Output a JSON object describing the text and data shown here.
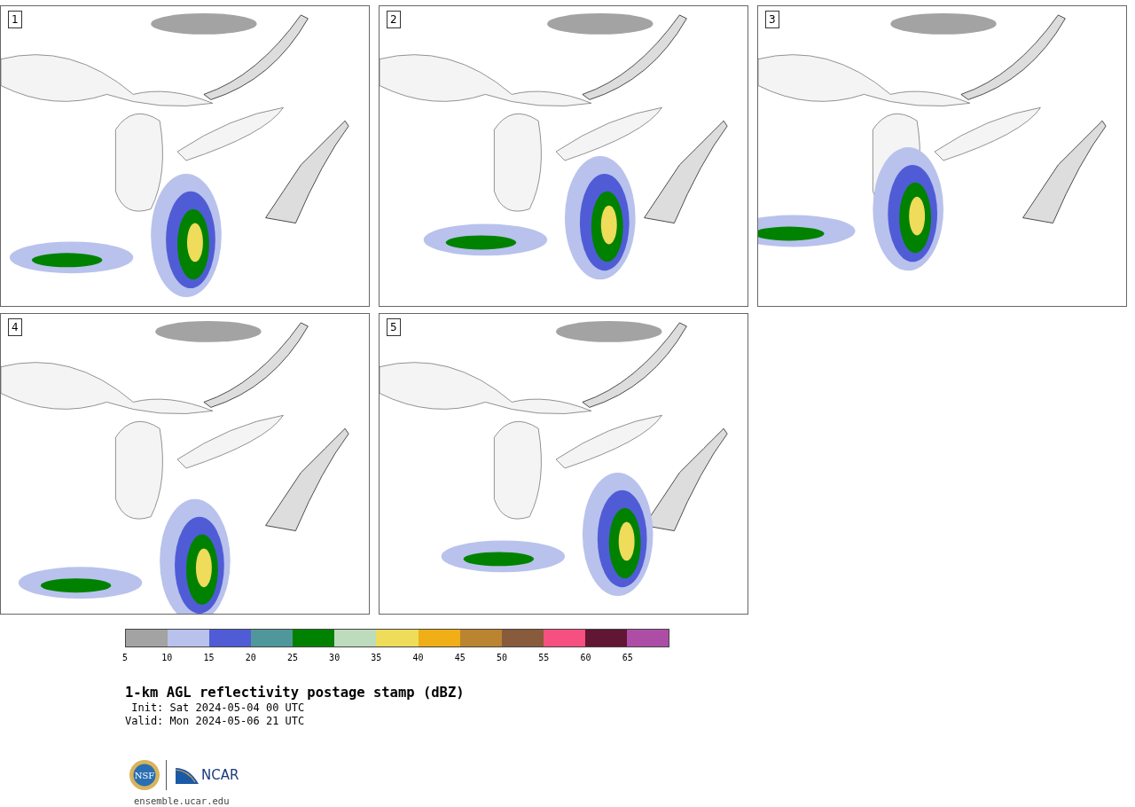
{
  "panels": [
    {
      "label": "1"
    },
    {
      "label": "2"
    },
    {
      "label": "3"
    },
    {
      "label": "4"
    },
    {
      "label": "5"
    }
  ],
  "colorbar": {
    "bins": [
      {
        "color": "#a3a3a3"
      },
      {
        "color": "#b8c2ec"
      },
      {
        "color": "#505cd6"
      },
      {
        "color": "#4f979b"
      },
      {
        "color": "#008200"
      },
      {
        "color": "#bddcbc"
      },
      {
        "color": "#eedc5a"
      },
      {
        "color": "#f0ae17"
      },
      {
        "color": "#bb8430"
      },
      {
        "color": "#885b3c"
      },
      {
        "color": "#f5507f"
      },
      {
        "color": "#611633"
      },
      {
        "color": "#ae4da6"
      }
    ],
    "ticks": [
      "5",
      "10",
      "15",
      "20",
      "25",
      "30",
      "35",
      "40",
      "45",
      "50",
      "55",
      "60",
      "65"
    ]
  },
  "title": "1-km AGL reflectivity postage stamp (dBZ)",
  "init": " Init: Sat 2024-05-04 00 UTC",
  "valid": "Valid: Mon 2024-05-06 21 UTC",
  "logos": {
    "nsf": "NSF",
    "ncar": "NCAR"
  },
  "url": "ensemble.ucar.edu"
}
